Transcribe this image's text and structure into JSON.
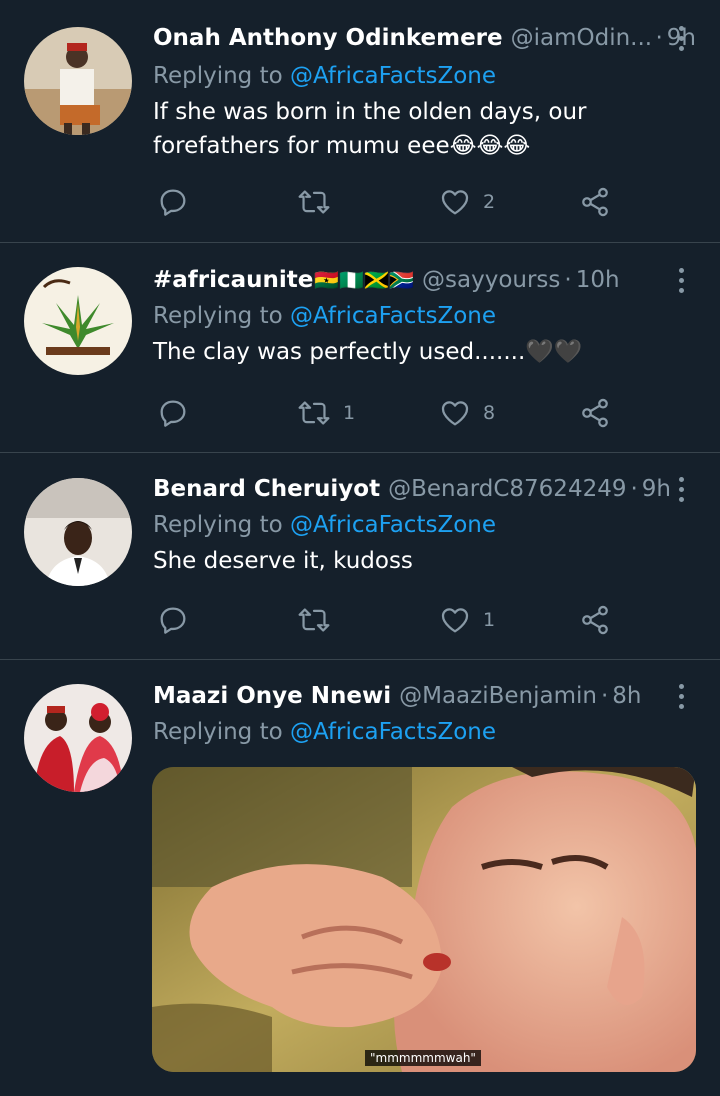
{
  "tweets": [
    {
      "name": "Onah Anthony Odinkemere",
      "flags": "",
      "handle": "@iamOdin...",
      "time": "9h",
      "replying_prefix": "Replying to ",
      "replying_to": "@AfricaFactsZone",
      "text": "If she was born in the olden days, our forefathers for mumu eee😂😂😂",
      "retweets": "",
      "likes": "2"
    },
    {
      "name": "#africaunite",
      "flags": "🇬🇭🇳🇬🇯🇲🇿🇦",
      "handle": "@sayyourss",
      "time": "10h",
      "replying_prefix": "Replying to ",
      "replying_to": "@AfricaFactsZone",
      "text": "The clay was perfectly used.......🖤🖤",
      "retweets": "1",
      "likes": "8"
    },
    {
      "name": "Benard Cheruiyot",
      "flags": "",
      "handle": "@BenardC87624249",
      "time": "9h",
      "replying_prefix": "Replying to ",
      "replying_to": "@AfricaFactsZone",
      "text": "She deserve it, kudoss",
      "retweets": "",
      "likes": "1"
    },
    {
      "name": "Maazi Onye Nnewi",
      "flags": "",
      "handle": "@MaaziBenjamin",
      "time": "8h",
      "replying_prefix": "Replying to ",
      "replying_to": "@AfricaFactsZone",
      "text": "",
      "media_caption": "\"mmmmmmwah\""
    }
  ],
  "separator": "·",
  "icons": {
    "reply": "reply-icon",
    "retweet": "retweet-icon",
    "like": "heart-icon",
    "share": "share-icon",
    "more": "more-options-icon"
  },
  "colors": {
    "background": "#15202b",
    "divider": "#38444d",
    "secondary_text": "#8899a6",
    "link": "#1da1f2"
  }
}
